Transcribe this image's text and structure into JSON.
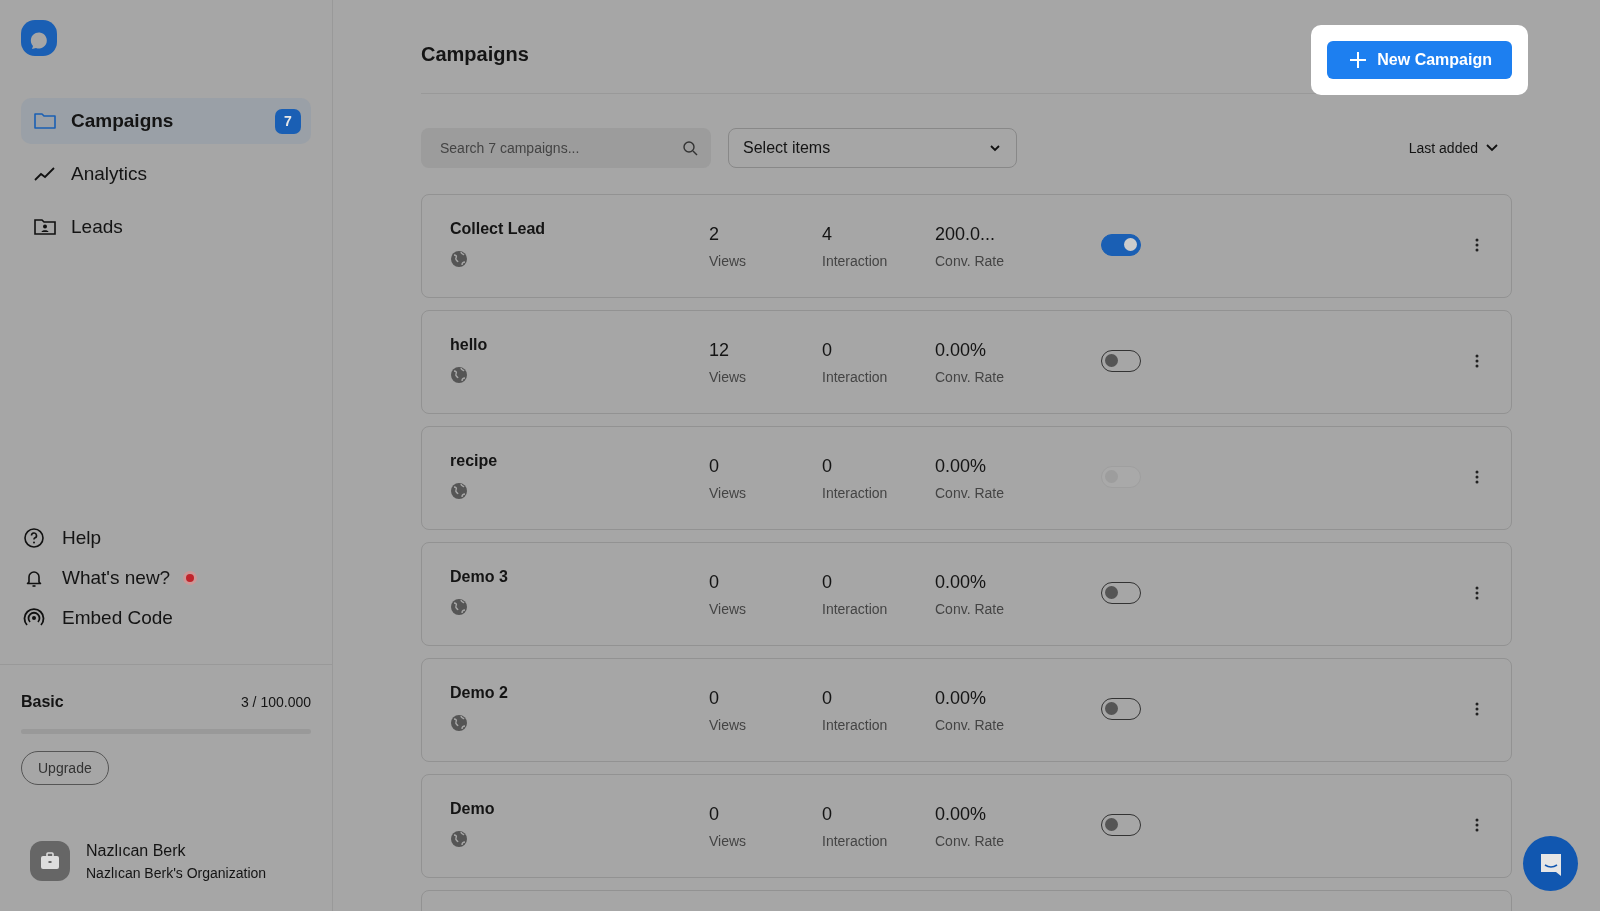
{
  "sidebar": {
    "nav": [
      {
        "label": "Campaigns",
        "badge": "7",
        "selected": true
      },
      {
        "label": "Analytics",
        "selected": false
      },
      {
        "label": "Leads",
        "selected": false
      }
    ],
    "footer_links": [
      {
        "label": "Help",
        "dot": false
      },
      {
        "label": "What's new?",
        "dot": true
      },
      {
        "label": "Embed Code",
        "dot": false
      }
    ],
    "plan": {
      "name": "Basic",
      "usage": "3 / 100.000",
      "button": "Upgrade"
    },
    "user": {
      "name": "Nazlıcan Berk",
      "organization": "Nazlıcan Berk's Organization"
    }
  },
  "header": {
    "title": "Campaigns",
    "new_button": "New Campaign"
  },
  "filters": {
    "search_placeholder": "Search 7 campaigns...",
    "select": "Select items",
    "sort": "Last added"
  },
  "campaigns": [
    {
      "name": "Collect Lead",
      "views": "2",
      "views_label": "Views",
      "interaction": "4",
      "interaction_label": "Interaction",
      "conv_rate": "200.0...",
      "conv_label": "Conv. Rate",
      "on": true,
      "disabled": false
    },
    {
      "name": "hello",
      "views": "12",
      "views_label": "Views",
      "interaction": "0",
      "interaction_label": "Interaction",
      "conv_rate": "0.00%",
      "conv_label": "Conv. Rate",
      "on": false,
      "disabled": false
    },
    {
      "name": "recipe",
      "views": "0",
      "views_label": "Views",
      "interaction": "0",
      "interaction_label": "Interaction",
      "conv_rate": "0.00%",
      "conv_label": "Conv. Rate",
      "on": false,
      "disabled": true
    },
    {
      "name": "Demo 3",
      "views": "0",
      "views_label": "Views",
      "interaction": "0",
      "interaction_label": "Interaction",
      "conv_rate": "0.00%",
      "conv_label": "Conv. Rate",
      "on": false,
      "disabled": false
    },
    {
      "name": "Demo 2",
      "views": "0",
      "views_label": "Views",
      "interaction": "0",
      "interaction_label": "Interaction",
      "conv_rate": "0.00%",
      "conv_label": "Conv. Rate",
      "on": false,
      "disabled": false
    },
    {
      "name": "Demo",
      "views": "0",
      "views_label": "Views",
      "interaction": "0",
      "interaction_label": "Interaction",
      "conv_rate": "0.00%",
      "conv_label": "Conv. Rate",
      "on": false,
      "disabled": false
    }
  ]
}
